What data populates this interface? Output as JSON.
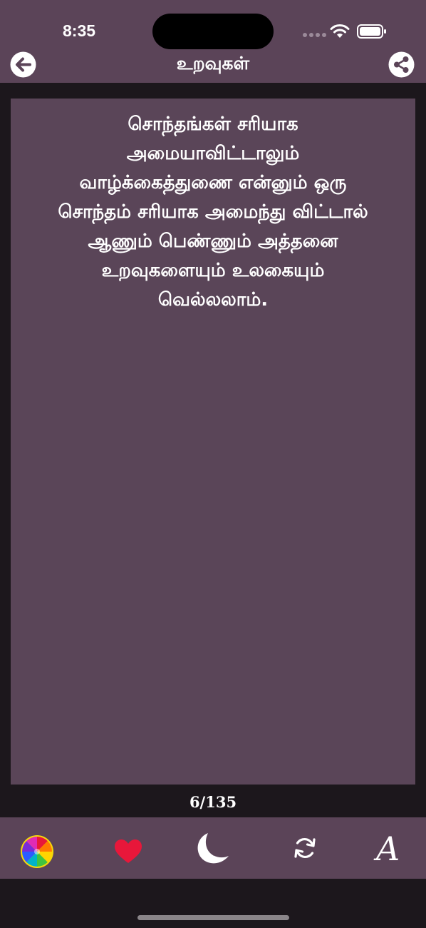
{
  "status_bar": {
    "time": "8:35"
  },
  "header": {
    "title": "உறவுகள்",
    "back_icon": "arrow-left-circle-icon",
    "share_icon": "share-icon"
  },
  "quote": {
    "lines": [
      "சொந்தங்கள் சரியாக",
      "அமையாவிட்டாலும்",
      "வாழ்க்கைத்துணை என்னும் ஒரு",
      "சொந்தம் சரியாக அமைந்து விட்டால்",
      "ஆணும் பெண்ணும் அத்தனை",
      "உறவுகளையும் உலகையும்",
      "வெல்லலாம்."
    ]
  },
  "pager": {
    "counter": "6/135"
  },
  "toolbar": {
    "font_label": "A",
    "icons": [
      "color-wheel-icon",
      "heart-icon",
      "feather-moon-icon",
      "refresh-icon",
      "font-icon"
    ]
  },
  "colors": {
    "header_bg": "#5b4458",
    "card_bg": "#5a4558",
    "page_bg": "#1c171c",
    "heart": "#e8173a"
  }
}
